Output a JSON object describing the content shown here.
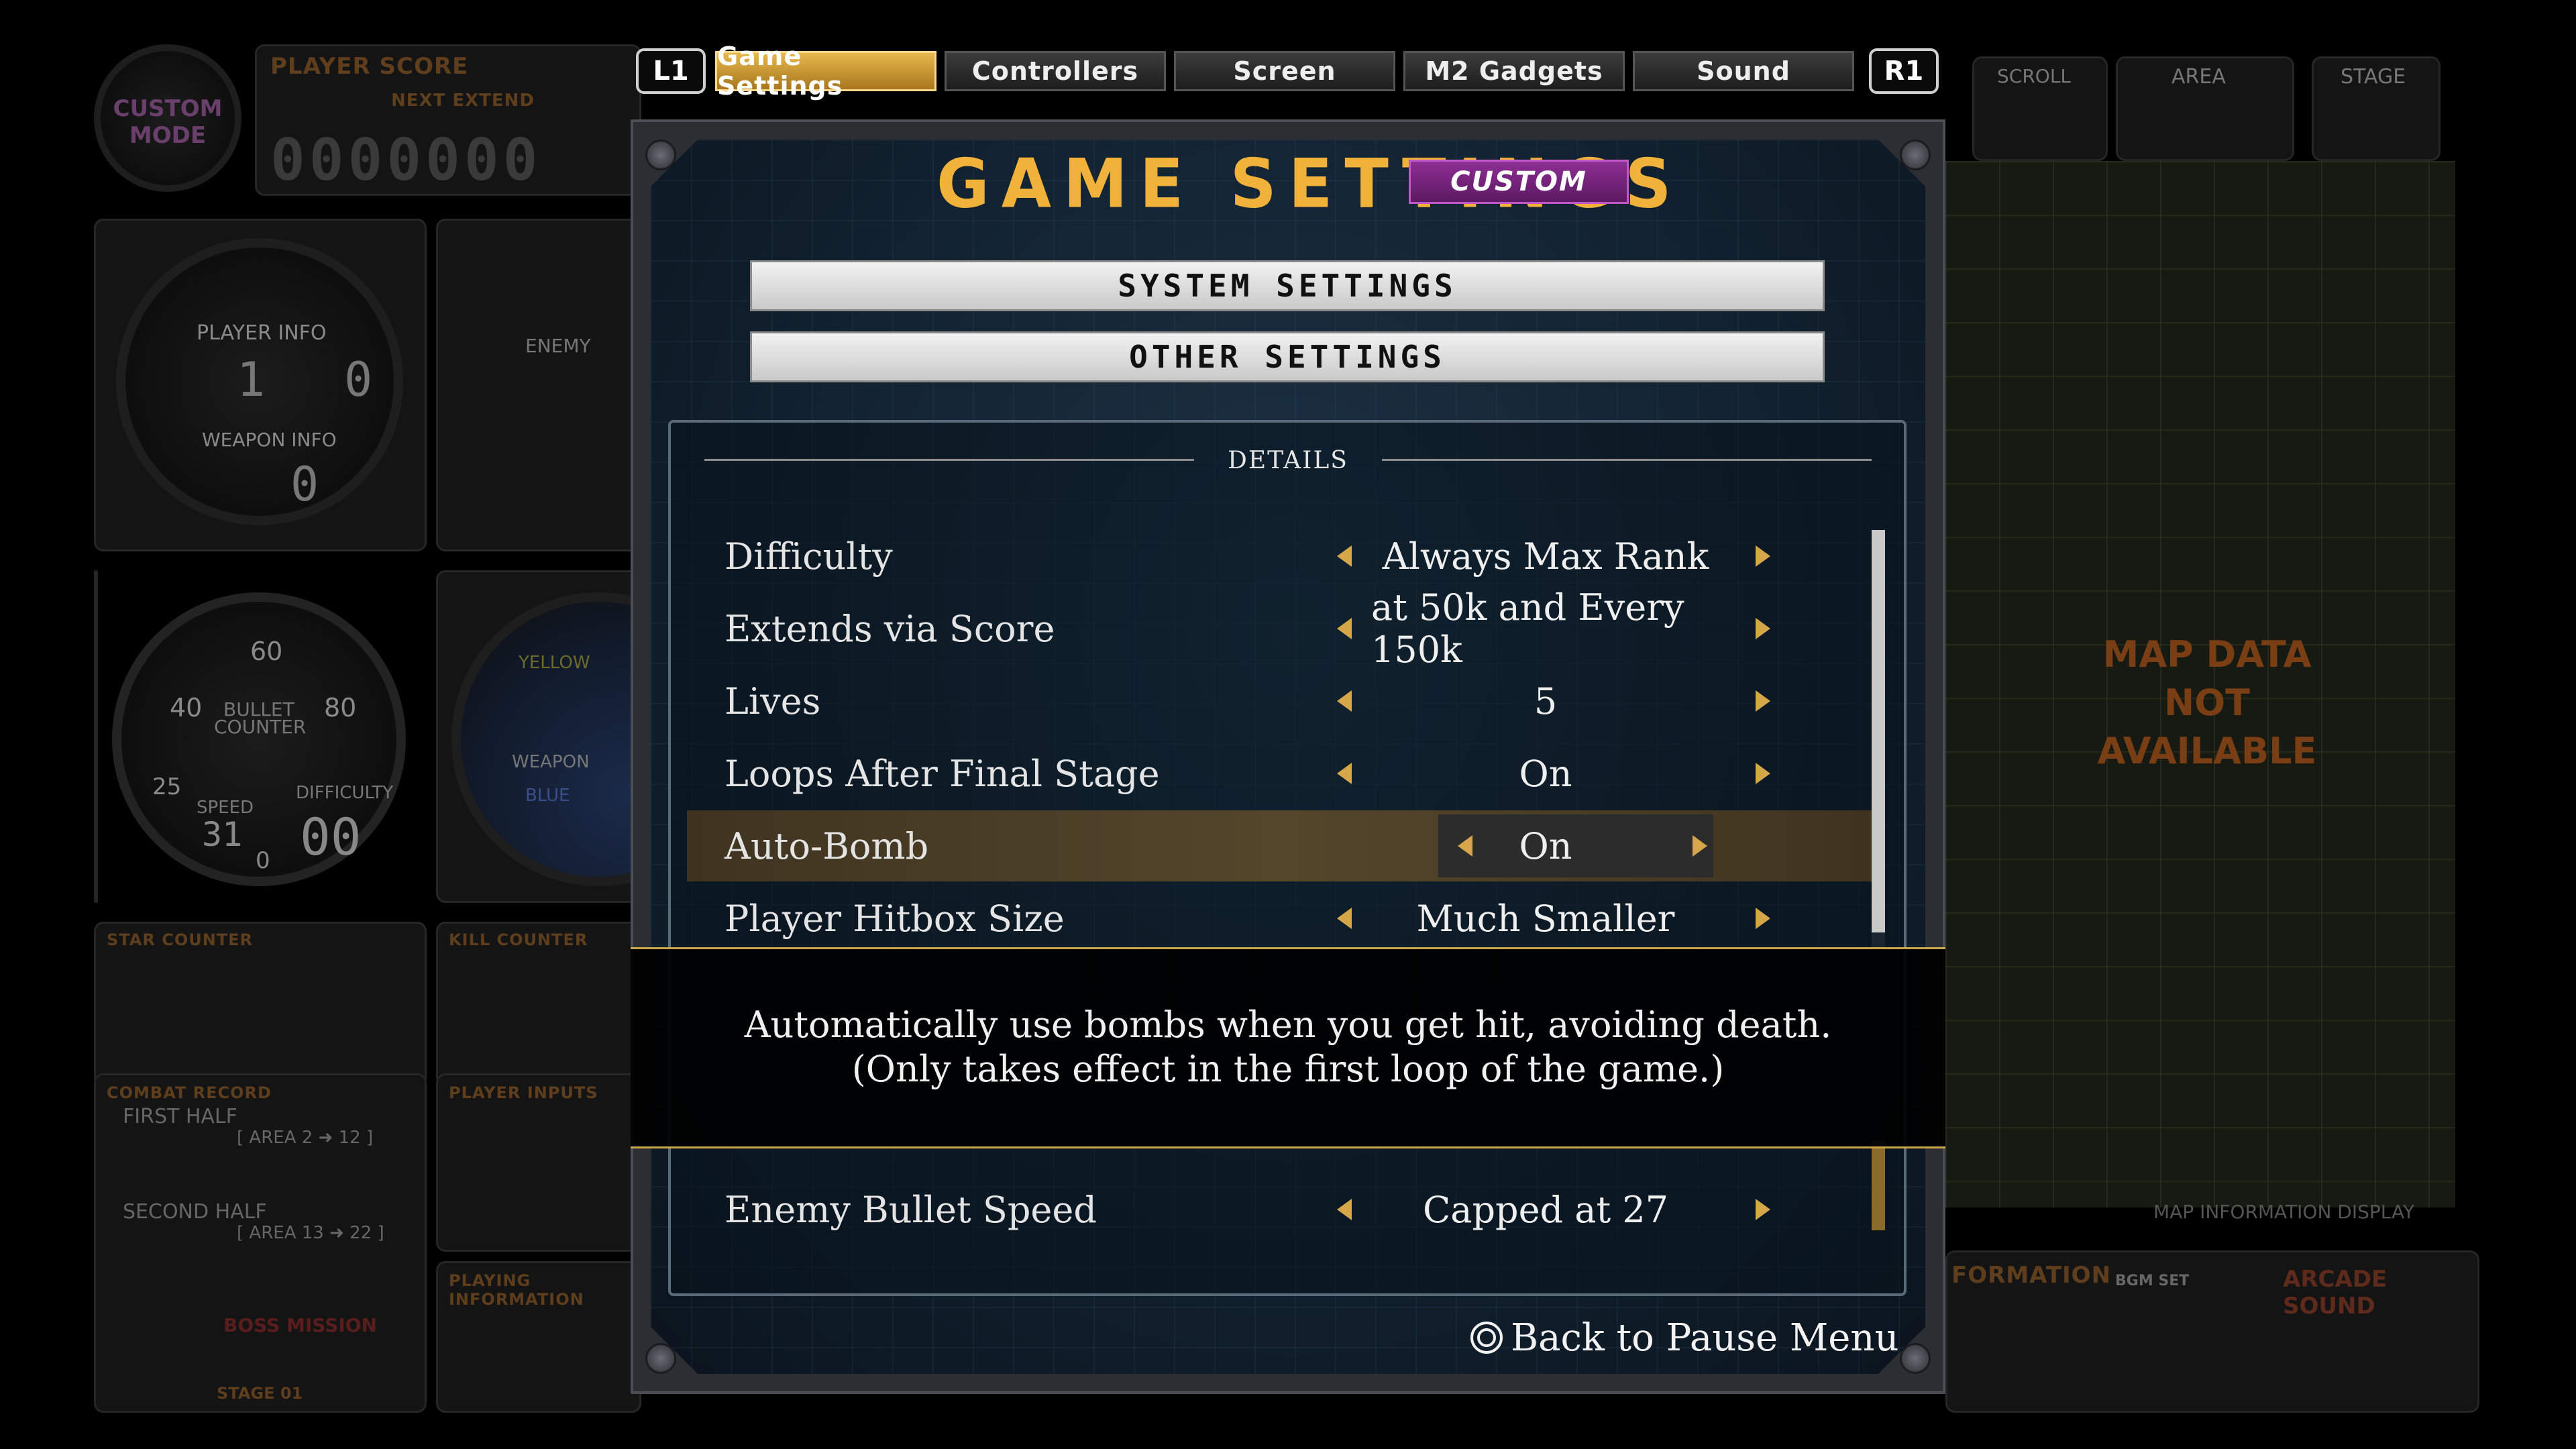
{
  "hud": {
    "mode_badge": [
      "CUSTOM",
      "MODE"
    ],
    "player_score_label": "PLAYER SCORE",
    "next_extend_label": "NEXT EXTEND",
    "score_digits": "0000000",
    "player_info_label": "PLAYER INFO",
    "player_lives": "1",
    "player_bombs": "0",
    "weapon_info_label": "WEAPON INFO",
    "weapon_level": "0",
    "enemy_label": "ENEMY",
    "bullet_counter_label": [
      "BULLET",
      "COUNTER"
    ],
    "gauge_ticks": [
      "60",
      "40",
      "80",
      "25",
      "0"
    ],
    "speed_label": "SPEED",
    "speed_value": "31",
    "difficulty_label": "DIFFICULTY",
    "difficulty_value": "00",
    "gauge2_labels": [
      "YELLOW",
      "WEAPON",
      "BLUE"
    ],
    "star_counter_label": "STAR COUNTER",
    "kill_counter_label": "KILL COUNTER",
    "combat_record_label": "COMBAT RECORD",
    "first_half": "FIRST HALF",
    "first_half_area": "[ AREA 2 ➜ 12 ]",
    "second_half": "SECOND HALF",
    "second_half_area": "[ AREA 13 ➜ 22 ]",
    "boss_mission": "BOSS MISSION",
    "stage_label": "STAGE 01",
    "player_inputs_label": "PLAYER INPUTS",
    "playing_information_label": "PLAYING INFORMATION",
    "scroll_label": "SCROLL",
    "area_label": "AREA",
    "stage_label_top": "STAGE",
    "map_note": [
      "MAP DATA",
      "NOT AVAILABLE"
    ],
    "map_info_display": "MAP INFORMATION DISPLAY",
    "information_label": "FORMATION",
    "bgm_set_label": "BGM SET",
    "arcade_sound_label": "ARCADE SOUND"
  },
  "tabs": {
    "left_shoulder": "L1",
    "right_shoulder": "R1",
    "items": [
      {
        "label": "Game Settings",
        "active": true
      },
      {
        "label": "Controllers",
        "active": false
      },
      {
        "label": "Screen",
        "active": false
      },
      {
        "label": "M2 Gadgets",
        "active": false
      },
      {
        "label": "Sound",
        "active": false
      }
    ]
  },
  "dialog": {
    "title": "GAME SETTINGS",
    "badge": "CUSTOM",
    "system_settings_button": "SYSTEM SETTINGS",
    "other_settings_button": "OTHER SETTINGS",
    "details_label": "DETAILS",
    "rows": [
      {
        "label": "Difficulty",
        "value": "Always Max Rank",
        "selected": false
      },
      {
        "label": "Extends via Score",
        "value": "at 50k and Every 150k",
        "selected": false
      },
      {
        "label": "Lives",
        "value": "5",
        "selected": false
      },
      {
        "label": "Loops After Final Stage",
        "value": "On",
        "selected": false
      },
      {
        "label": "Auto-Bomb",
        "value": "On",
        "selected": true
      },
      {
        "label": "Player Hitbox Size",
        "value": "Much Smaller",
        "selected": false
      },
      {
        "label": "Enemy Bullet Speed",
        "value": "Capped at 27",
        "selected": false
      }
    ],
    "tooltip": [
      "Automatically use bombs when you get hit, avoiding death.",
      "(Only takes effect in the first loop of the game.)"
    ],
    "back_label": "Back to Pause Menu"
  },
  "colors": {
    "accent_gold": "#f0b23a",
    "badge_purple": "#8d2e94",
    "selected_row": "#54462b"
  }
}
